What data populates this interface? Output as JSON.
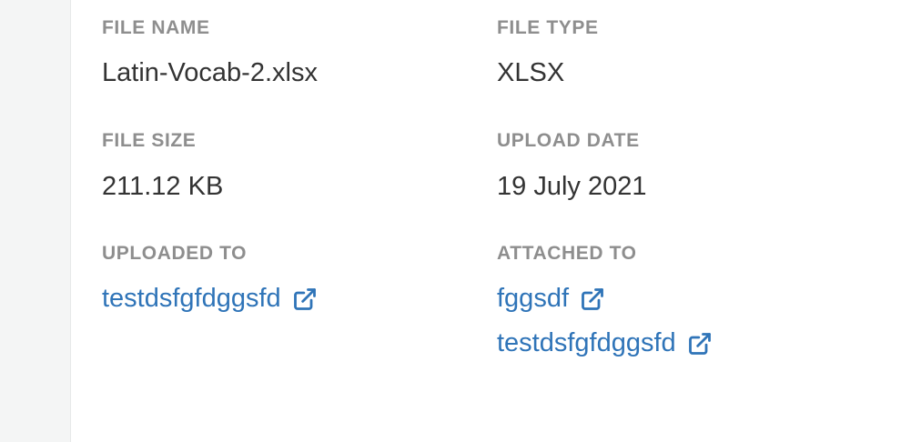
{
  "details": {
    "file_name": {
      "label": "FILE NAME",
      "value": "Latin-Vocab-2.xlsx"
    },
    "file_type": {
      "label": "FILE TYPE",
      "value": "XLSX"
    },
    "file_size": {
      "label": "FILE SIZE",
      "value": "211.12 KB"
    },
    "upload_date": {
      "label": "UPLOAD DATE",
      "value": "19 July 2021"
    },
    "uploaded_to": {
      "label": "UPLOADED TO",
      "links": [
        {
          "text": "testdsfgfdggsfd",
          "icon": "external-link-icon"
        }
      ]
    },
    "attached_to": {
      "label": "ATTACHED TO",
      "links": [
        {
          "text": "fggsdf",
          "icon": "external-link-icon"
        },
        {
          "text": "testdsfgfdggsfd",
          "icon": "external-link-icon"
        }
      ]
    }
  },
  "colors": {
    "label": "#8e8e8e",
    "value": "#333333",
    "link": "#2f74b8",
    "sidebar": "#f4f5f5"
  }
}
